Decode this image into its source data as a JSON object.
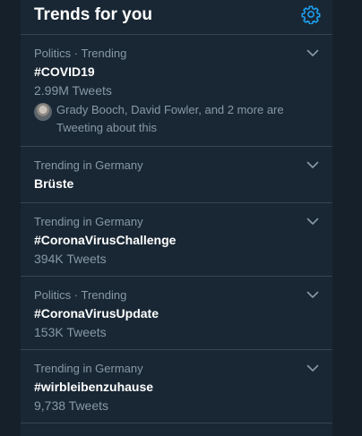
{
  "panel": {
    "title": "Trends for you",
    "settings_icon": "gear-icon"
  },
  "trends": [
    {
      "context": "Politics · Trending",
      "name": "#COVID19",
      "count": "2.99M Tweets",
      "related": "Grady Booch, David Fowler, and 2 more are Tweeting about this"
    },
    {
      "context": "Trending in Germany",
      "name": "Brüste"
    },
    {
      "context": "Trending in Germany",
      "name": "#CoronaVirusChallenge",
      "count": "394K Tweets"
    },
    {
      "context": "Politics · Trending",
      "name": "#CoronaVirusUpdate",
      "count": "153K Tweets"
    },
    {
      "context": "Trending in Germany",
      "name": "#wirbleibenzuhause",
      "count": "9,738 Tweets"
    }
  ],
  "colors": {
    "background": "#15202b",
    "panel": "#192734",
    "divider": "#38444d",
    "accent": "#1da1f2",
    "secondary_text": "#8899a6"
  }
}
